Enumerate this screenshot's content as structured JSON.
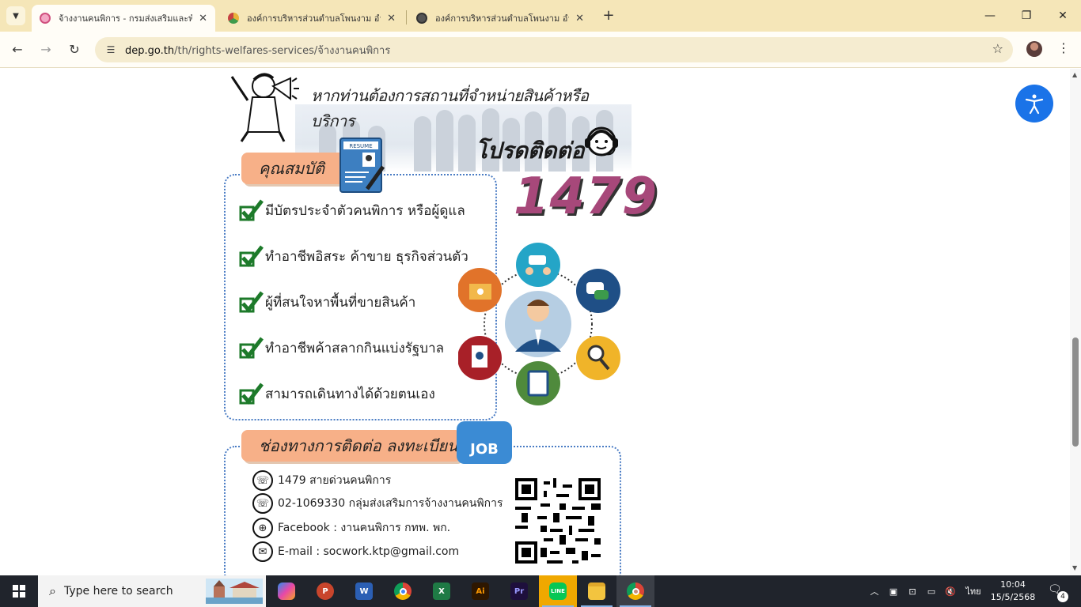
{
  "browser": {
    "tabs": [
      {
        "title": "จ้างงานคนพิการ - กรมส่งเสริมและพัฒ",
        "active": true
      },
      {
        "title": "องค์การบริหารส่วนตำบลโพนงาม อำเภ",
        "active": false
      },
      {
        "title": "องค์การบริหารส่วนตำบลโพนงาม อำเภ",
        "active": false
      }
    ],
    "url_host": "dep.go.th",
    "url_path": "/th/rights-welfares-services/จ้างงานคนพิการ"
  },
  "poster": {
    "heading": "หากท่านต้องการสถานที่จำหน่ายสินค้าหรือบริการ",
    "please_contact": "โปรดติดต่อ",
    "hotline_number": "1479",
    "resume_label": "RESUME",
    "qualifications_title": "คุณสมบัติ",
    "qualifications": [
      "มีบัตรประจำตัวคนพิการ หรือผู้ดูแล",
      "ทำอาชีพอิสระ ค้าขาย ธุรกิจส่วนตัว",
      "ผู้ที่สนใจหาพื้นที่ขายสินค้า",
      "ทำอาชีพค้าสลากกินแบ่งรัฐบาล",
      "สามารถเดินทางได้ด้วยตนเอง"
    ],
    "contact_title": "ช่องทางการติดต่อ ลงทะเบียน",
    "job_badge": "JOB",
    "contacts": [
      "1479 สายด่วนคนพิการ",
      "02-1069330 กลุ่มส่งเสริมการจ้างงานคนพิการ",
      "Facebook : งานคนพิการ กทพ. พก.",
      "E-mail : socwork.ktp@gmail.com"
    ]
  },
  "taskbar": {
    "search_placeholder": "Type here to search",
    "apps": [
      "Copilot",
      "PowerPoint",
      "Word",
      "Chrome",
      "Excel",
      "Illustrator",
      "Premiere Pro",
      "LINE",
      "File Explorer",
      "Chrome"
    ],
    "language": "ไทย",
    "time": "10:04",
    "date": "15/5/2568",
    "notification_count": "4"
  }
}
